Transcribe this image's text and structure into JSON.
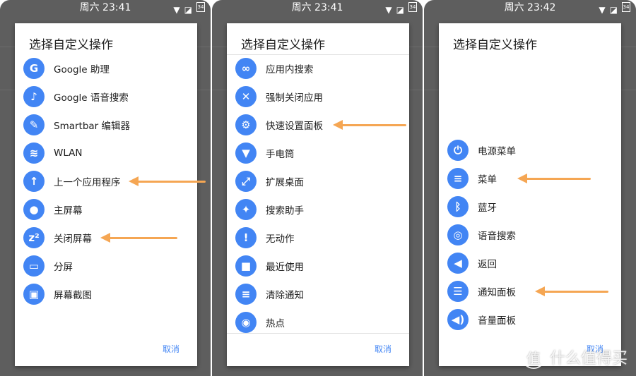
{
  "accent": "#4285f4",
  "arrow_color": "#f5a653",
  "panels": [
    {
      "time": "周六 23:41",
      "title": "选择自定义操作",
      "cancel": "取消",
      "items": [
        {
          "label": "Google 助理",
          "icon": "google-icon"
        },
        {
          "label": "Google 语音搜索",
          "icon": "mic-icon"
        },
        {
          "label": "Smartbar 编辑器",
          "icon": "edit-icon"
        },
        {
          "label": "WLAN",
          "icon": "wifi-icon"
        },
        {
          "label": "上一个应用程序",
          "icon": "previous-app-icon"
        },
        {
          "label": "主屏幕",
          "icon": "home-icon"
        },
        {
          "label": "关闭屏幕",
          "icon": "sleep-icon"
        },
        {
          "label": "分屏",
          "icon": "split-screen-icon"
        },
        {
          "label": "屏幕截图",
          "icon": "screenshot-icon"
        }
      ]
    },
    {
      "time": "周六 23:41",
      "title": "选择自定义操作",
      "cancel": "取消",
      "items": [
        {
          "label": "应用内搜索",
          "icon": "binoculars-icon"
        },
        {
          "label": "强制关闭应用",
          "icon": "close-icon"
        },
        {
          "label": "快速设置面板",
          "icon": "settings-icon"
        },
        {
          "label": "手电筒",
          "icon": "flashlight-icon"
        },
        {
          "label": "扩展桌面",
          "icon": "fullscreen-icon"
        },
        {
          "label": "搜索助手",
          "icon": "assistant-icon"
        },
        {
          "label": "无动作",
          "icon": "alert-icon"
        },
        {
          "label": "最近使用",
          "icon": "recents-icon"
        },
        {
          "label": "清除通知",
          "icon": "clear-notifications-icon"
        },
        {
          "label": "热点",
          "icon": "hotspot-icon"
        }
      ]
    },
    {
      "time": "周六 23:42",
      "title": "选择自定义操作",
      "cancel": "取消",
      "items": [
        {
          "label": "电源菜单",
          "icon": "power-icon"
        },
        {
          "label": "菜单",
          "icon": "menu-icon"
        },
        {
          "label": "蓝牙",
          "icon": "bluetooth-icon"
        },
        {
          "label": "语音搜索",
          "icon": "voice-search-icon"
        },
        {
          "label": "返回",
          "icon": "back-icon"
        },
        {
          "label": "通知面板",
          "icon": "notification-list-icon"
        },
        {
          "label": "音量面板",
          "icon": "volume-icon"
        }
      ]
    }
  ],
  "watermark": "值 什么值得买"
}
